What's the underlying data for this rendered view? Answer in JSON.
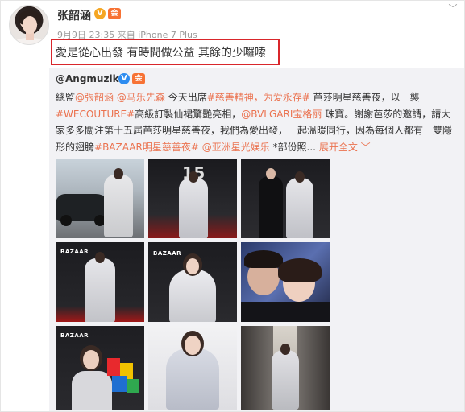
{
  "post": {
    "author": "张韶涵",
    "badges": {
      "verified": "V",
      "member": "会"
    },
    "meta": {
      "time": "9月9日 23:35",
      "source_prefix": "来自",
      "source": "iPhone 7 Plus"
    },
    "text": "愛是從心出發 有時間做公益 其餘的少囉嗦",
    "more_icon": "chevron-down-icon"
  },
  "repost": {
    "author": "@Angmuzik",
    "badges": {
      "verified": "V",
      "member": "会"
    },
    "segments": [
      {
        "t": "總監",
        "link": false
      },
      {
        "t": "@張韶涵",
        "link": true
      },
      {
        "t": " ",
        "link": false
      },
      {
        "t": "@马乐先森",
        "link": true
      },
      {
        "t": " 今天出席",
        "link": false
      },
      {
        "t": "#慈善精神，为爱永存#",
        "link": true
      },
      {
        "t": " 芭莎明星慈善夜，以一襲",
        "link": false
      },
      {
        "t": "#WECOUTURE#",
        "link": true
      },
      {
        "t": "高級訂製仙裙驚艷亮相，",
        "link": false
      },
      {
        "t": "@BVLGARI宝格丽",
        "link": true
      },
      {
        "t": " 珠寶。謝謝芭莎的邀請，請大家多多關注第十五屆芭莎明星慈善夜，我們為愛出發，一起溫暖同行，因為每個人都有一雙隱形的翅膀",
        "link": false
      },
      {
        "t": "#BAZAAR明星慈善夜#",
        "link": true
      },
      {
        "t": " ",
        "link": false
      },
      {
        "t": "@亚洲星光娱乐",
        "link": true
      },
      {
        "t": " *部份照... ",
        "link": false
      },
      {
        "t": "展开全文 ﹀",
        "link": true
      }
    ],
    "photos": [
      {
        "name": "photo-car-outdoor",
        "label": ""
      },
      {
        "name": "photo-red-carpet-1",
        "label": "15"
      },
      {
        "name": "photo-with-man-black-suit",
        "label": ""
      },
      {
        "name": "photo-bazaar-backdrop-full",
        "label": "BAZAAR"
      },
      {
        "name": "photo-bazaar-closeup",
        "label": "BAZAAR"
      },
      {
        "name": "photo-selfie-two",
        "label": ""
      },
      {
        "name": "photo-media-microphones",
        "label": "BAZAAR"
      },
      {
        "name": "photo-corridor-portrait",
        "label": ""
      },
      {
        "name": "photo-corridor-walking",
        "label": ""
      }
    ]
  }
}
